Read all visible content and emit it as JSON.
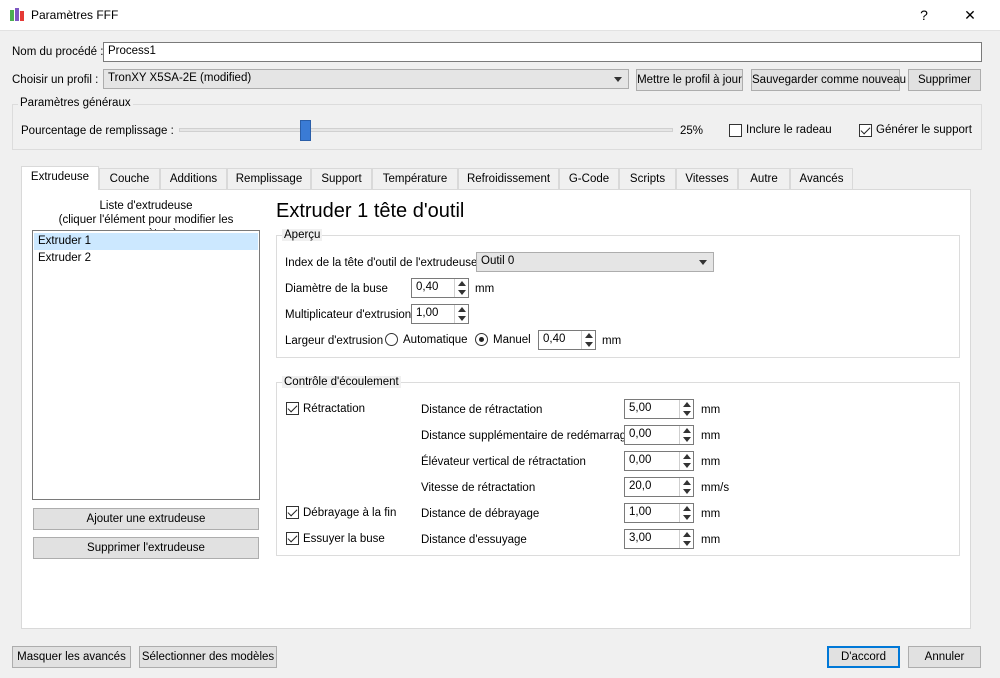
{
  "window": {
    "title": "Paramètres FFF",
    "help_label": "?",
    "close_label": "✕"
  },
  "process": {
    "label": "Nom du procédé :",
    "value": "Process1"
  },
  "profile": {
    "label": "Choisir un profil :",
    "selected": "TronXY X5SA-2E (modified)",
    "update_label": "Mettre le profil à jour",
    "save_new_label": "Sauvegarder comme nouveau",
    "delete_label": "Supprimer"
  },
  "general": {
    "title": "Paramètres généraux",
    "infill_label": "Pourcentage de remplissage :",
    "infill_value": "25%",
    "infill_fraction": 0.25,
    "raft_label": "Inclure le radeau",
    "raft_checked": false,
    "support_label": "Générer le support",
    "support_checked": true
  },
  "tabs": [
    "Extrudeuse",
    "Couche",
    "Additions",
    "Remplissage",
    "Support",
    "Température",
    "Refroidissement",
    "G-Code",
    "Scripts",
    "Vitesses",
    "Autre",
    "Avancés"
  ],
  "active_tab": 0,
  "extruder_list": {
    "title_line1": "Liste d'extrudeuse",
    "title_line2": "(cliquer l'élément pour modifier les paramètres)",
    "items": [
      "Extruder 1",
      "Extruder 2"
    ],
    "selected": 0,
    "add_label": "Ajouter une extrudeuse",
    "remove_label": "Supprimer l'extrudeuse"
  },
  "detail": {
    "heading": "Extruder 1 tête d'outil",
    "overview": {
      "title": "Aperçu",
      "tool_index_label": "Index de la tête d'outil de l'extrudeuse",
      "tool_index_value": "Outil 0",
      "nozzle_label": "Diamètre de la buse",
      "nozzle_value": "0,40",
      "nozzle_unit": "mm",
      "multiplier_label": "Multiplicateur d'extrusion",
      "multiplier_value": "1,00",
      "width_label": "Largeur d'extrusion",
      "auto_label": "Automatique",
      "manual_label": "Manuel",
      "width_value": "0,40",
      "width_unit": "mm"
    },
    "flow": {
      "title": "Contrôle d'écoulement",
      "retraction_label": "Rétractation",
      "retraction_checked": true,
      "coast_label": "Débrayage à la fin",
      "coast_checked": true,
      "wipe_label": "Essuyer la buse",
      "wipe_checked": true,
      "fields": [
        {
          "label": "Distance de rétractation",
          "value": "5,00",
          "unit": "mm"
        },
        {
          "label": "Distance supplémentaire de redémarrage",
          "value": "0,00",
          "unit": "mm"
        },
        {
          "label": "Élévateur vertical de rétractation",
          "value": "0,00",
          "unit": "mm"
        },
        {
          "label": "Vitesse de rétractation",
          "value": "20,0",
          "unit": "mm/s"
        },
        {
          "label": "Distance de débrayage",
          "value": "1,00",
          "unit": "mm"
        },
        {
          "label": "Distance d'essuyage",
          "value": "3,00",
          "unit": "mm"
        }
      ]
    }
  },
  "footer": {
    "hide_advanced_label": "Masquer les avancés",
    "select_models_label": "Sélectionner des modèles",
    "ok_label": "D'accord",
    "cancel_label": "Annuler"
  },
  "colors": {
    "accent": "#0078d7",
    "slider_handle": "#3a7bd5",
    "selection": "#cce8ff"
  }
}
